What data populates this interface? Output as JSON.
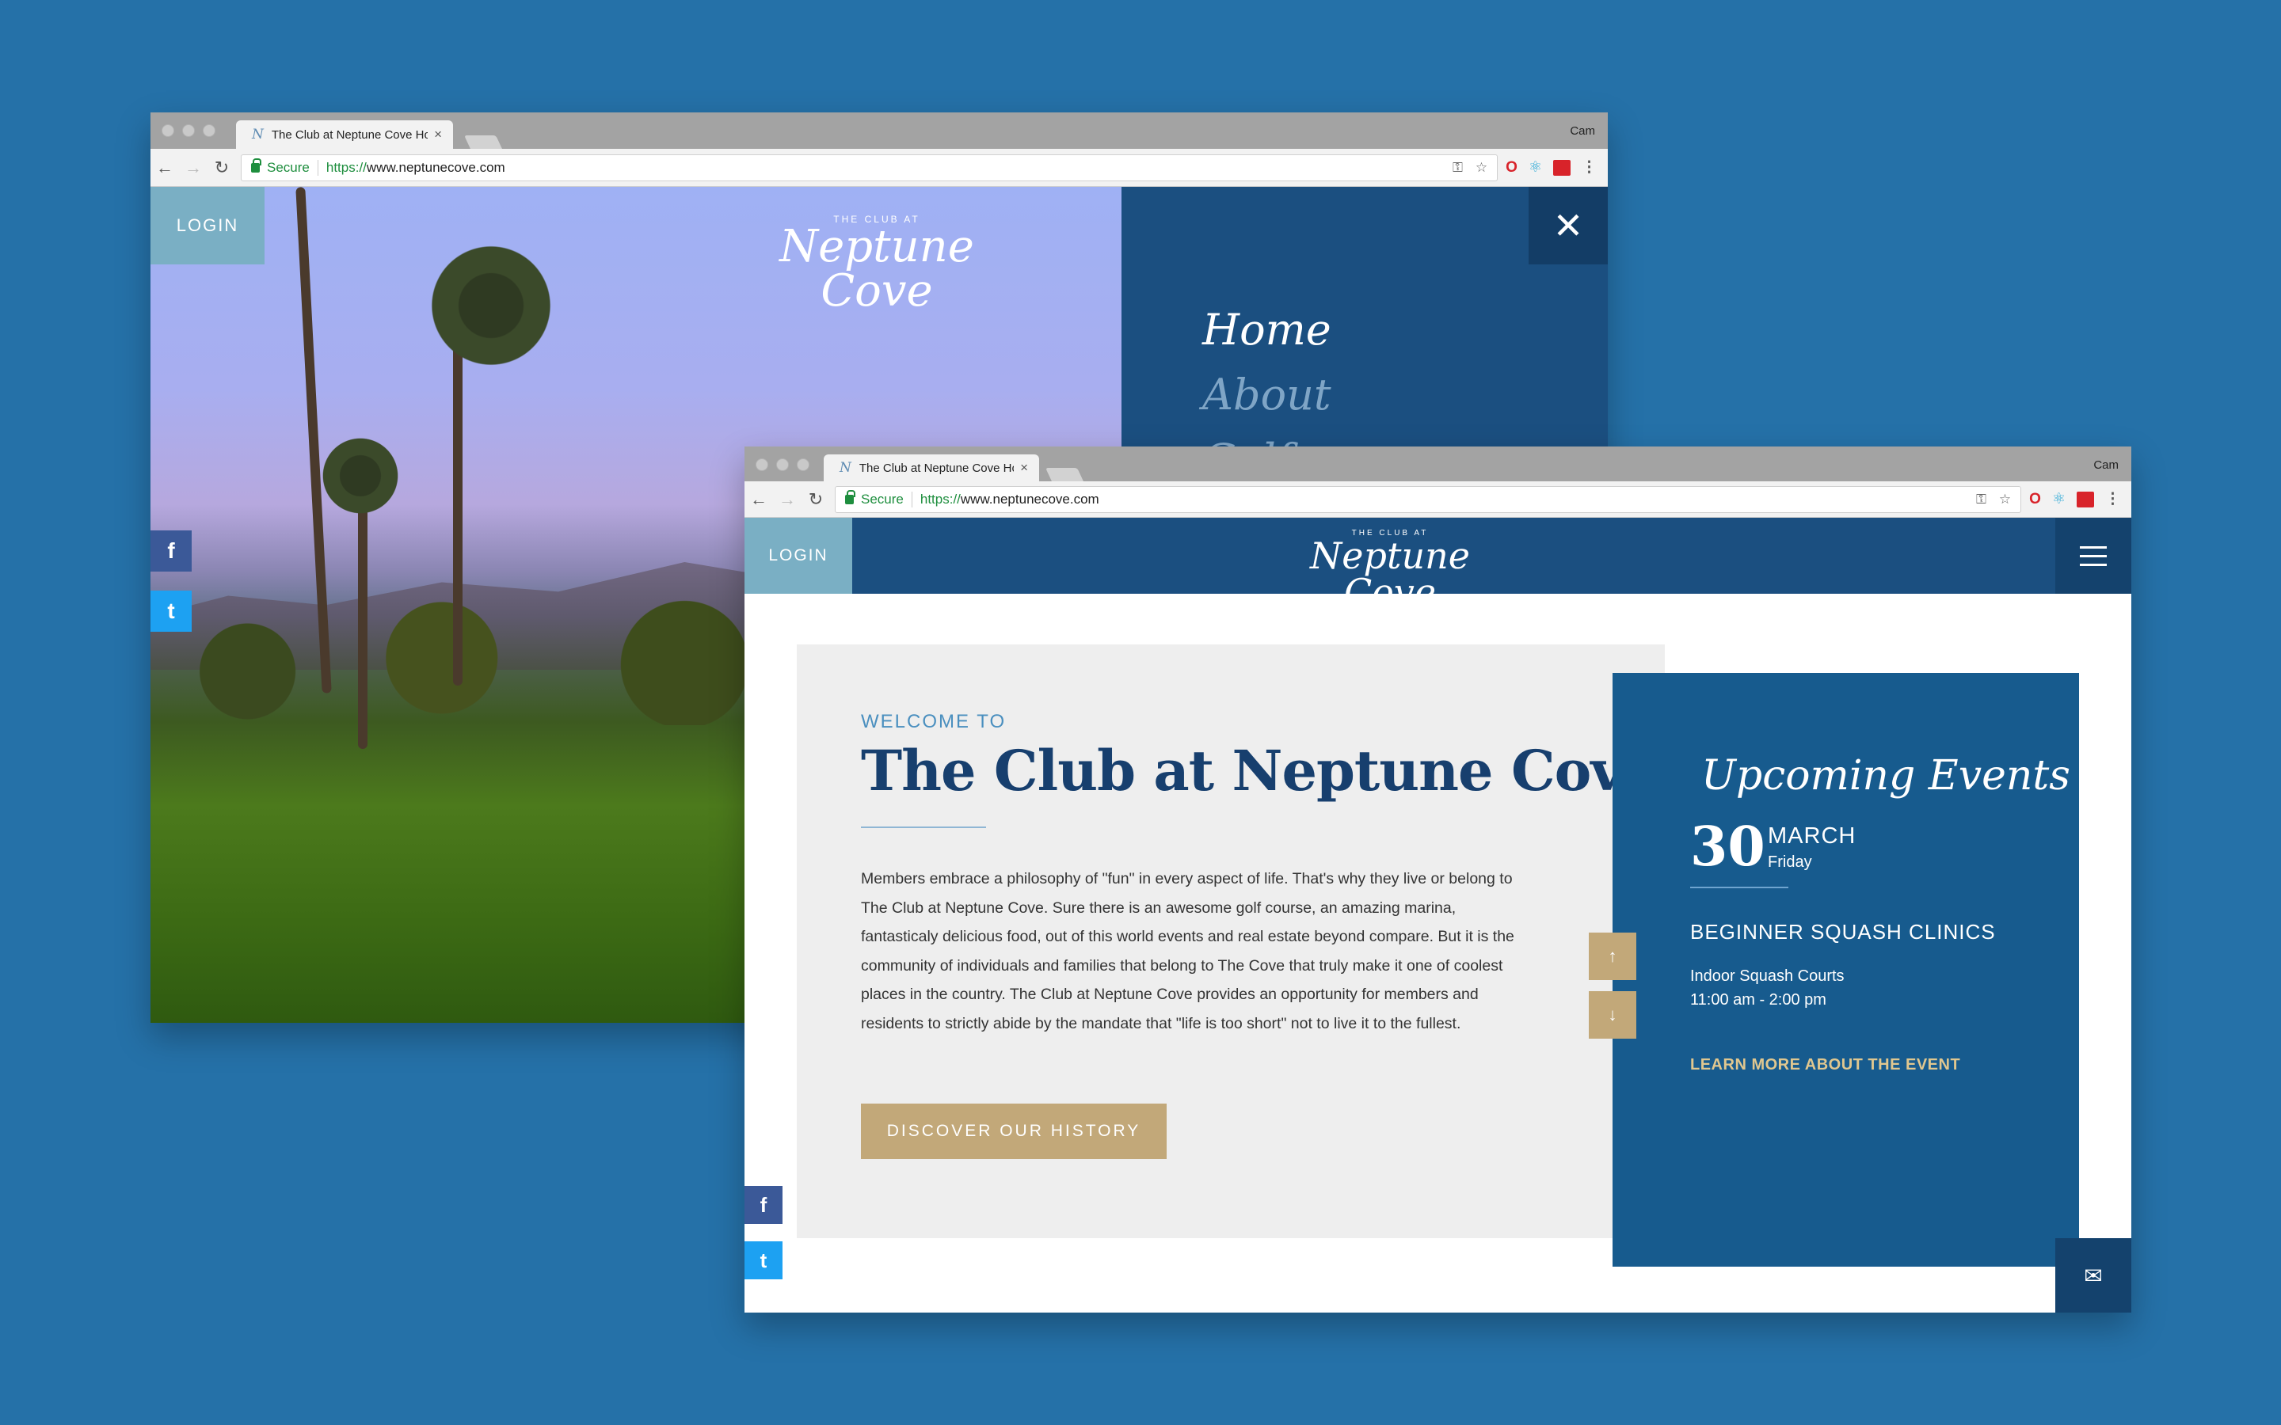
{
  "browser": {
    "tab_title": "The Club at Neptune Cove Hom",
    "tab_favicon": "N",
    "tab_close": "×",
    "profile": "Cam",
    "secure_label": "Secure",
    "url_scheme": "https://",
    "url_host": "www.neptunecove.com",
    "back": "←",
    "forward": "→",
    "reload": "↻",
    "key_icon": "⚿",
    "star_icon": "☆",
    "opera_icon": "O",
    "react_icon": "⚛",
    "menu_icon": "⋮"
  },
  "site": {
    "login": "LOGIN",
    "logo_small": "THE CLUB AT",
    "logo_script": "Neptune Cove",
    "facebook": "f",
    "twitter": "t"
  },
  "menu": {
    "close": "✕",
    "items": [
      "Home",
      "About",
      "Golf"
    ]
  },
  "welcome": {
    "label": "WELCOME TO",
    "title": "The Club at Neptune Cove",
    "body": "Members embrace a philosophy of \"fun\" in every aspect of life. That's why they live or belong to The Club at Neptune Cove. Sure there is an awesome golf course, an amazing marina, fantasticaly delicious food, out of this world events and real estate beyond compare. But it is the community of individuals and families that belong to The Cove that truly make it one of coolest places in the country. The Club at Neptune Cove provides an opportunity for members and residents to strictly abide by the mandate that \"life is too short\" not to live it to the fullest.",
    "button": "DISCOVER OUR HISTORY"
  },
  "events": {
    "title": "Upcoming Events",
    "day": "30",
    "month": "MARCH",
    "weekday": "Friday",
    "name": "BEGINNER SQUASH CLINICS",
    "location": "Indoor Squash Courts",
    "time": "11:00 am - 2:00 pm",
    "link": "LEARN MORE ABOUT THE EVENT",
    "arrow_up": "↑",
    "arrow_down": "↓"
  },
  "mail_icon": "✉",
  "colors": {
    "background": "#2571a8",
    "navy": "#1b4f80",
    "events_blue": "#175b8e",
    "gold": "#c2a879",
    "login_teal": "#7aafc4"
  }
}
